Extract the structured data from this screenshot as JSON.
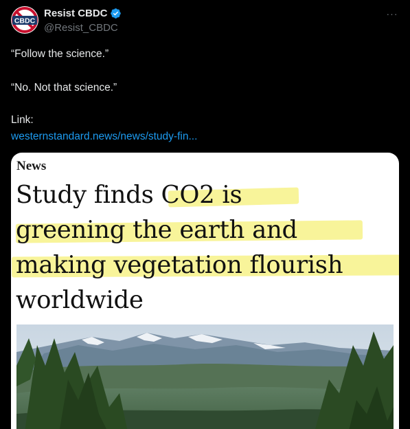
{
  "author": {
    "avatar_text": "CBDC",
    "display_name": "Resist CBDC",
    "handle": "@Resist_CBDC",
    "verified": true
  },
  "more_label": "···",
  "tweet": {
    "line_1": "“Follow the science.”",
    "line_2": "“No. Not that science.”",
    "line_3": "Link:",
    "link": "westernstandard.news/news/study-fin..."
  },
  "card": {
    "section": "News",
    "headline_lines": [
      "Study finds CO2 is",
      "greening the earth and",
      "making vegetation flourish",
      "worldwide"
    ],
    "highlight_color": "#f6f078"
  },
  "colors": {
    "background": "#000000",
    "text": "#e7e9ea",
    "secondary_text": "#71767b",
    "link": "#1d9bf0",
    "verified_badge": "#1d9bf0"
  },
  "icons": {
    "avatar": "cbdc-prohibited-logo-icon",
    "verified": "verified-badge-icon",
    "more": "more-horizontal-icon"
  }
}
